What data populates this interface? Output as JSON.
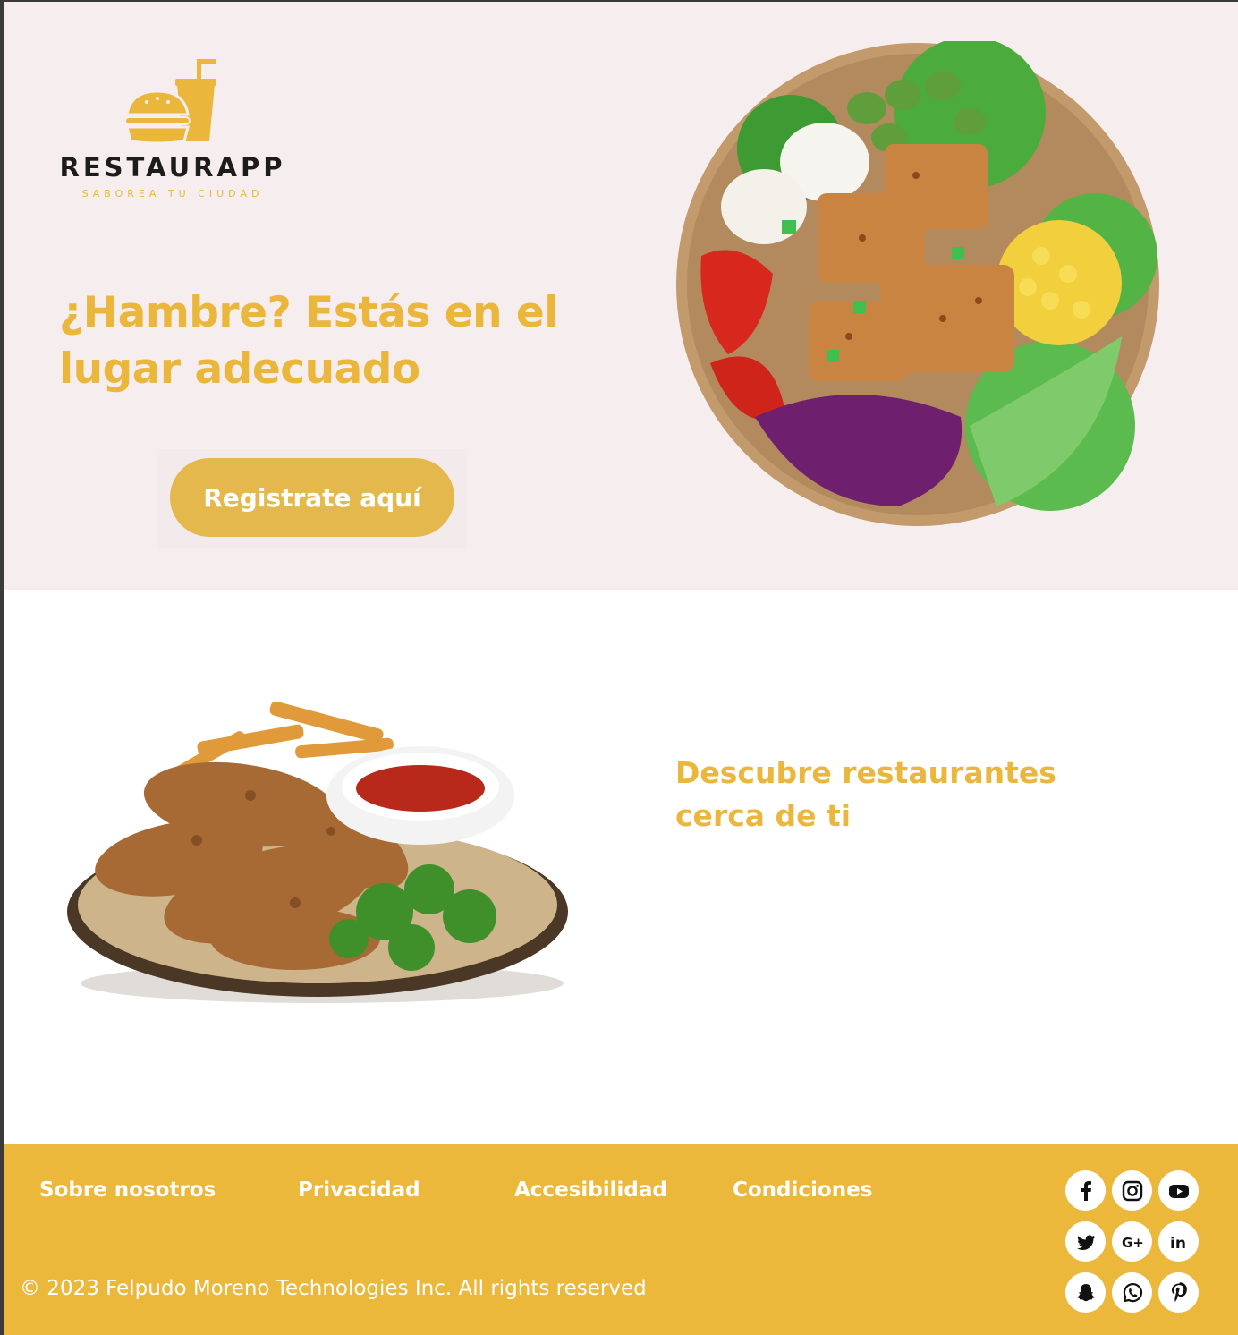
{
  "brand": {
    "name": "RESTAURAPP",
    "tagline": "SABOREA TU CIUDAD"
  },
  "hero": {
    "title": "¿Hambre? Estás en el lugar adecuado",
    "cta_label": "Registrate aquí"
  },
  "feature": {
    "title": "Descubre restaurantes cerca de ti"
  },
  "footer": {
    "links": [
      "Sobre nosotros",
      "Privacidad",
      "Accesibilidad",
      "Condiciones"
    ],
    "copyright": "© 2023 Felpudo Moreno Technologies Inc. All rights reserved",
    "social": [
      "facebook-icon",
      "instagram-icon",
      "youtube-icon",
      "twitter-icon",
      "google-plus-icon",
      "linkedin-icon",
      "snapchat-icon",
      "whatsapp-icon",
      "pinterest-icon"
    ]
  },
  "colors": {
    "accent": "#eab73c",
    "hero_bg": "#f6eeee",
    "footer_bg": "#ebb83c",
    "button": "#e5b84d"
  }
}
